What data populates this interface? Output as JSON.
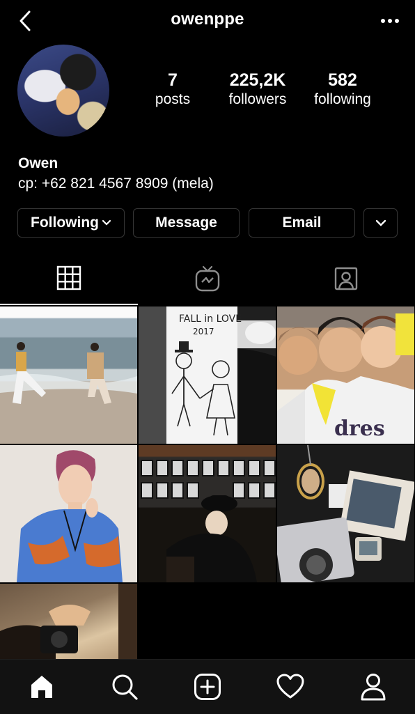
{
  "header": {
    "username": "owenppe",
    "back_icon": "chevron-left-icon",
    "more_icon": "ellipsis-icon"
  },
  "profile": {
    "stats": [
      {
        "count": "7",
        "label": "posts"
      },
      {
        "count": "225,2K",
        "label": "followers"
      },
      {
        "count": "582",
        "label": "following"
      }
    ],
    "name": "Owen",
    "bio": "cp: +62 821 4567 8909 (mela)"
  },
  "actions": {
    "following": "Following",
    "message": "Message",
    "email": "Email"
  },
  "tabs": [
    {
      "icon": "grid-icon",
      "active": true
    },
    {
      "icon": "igtv-icon",
      "active": false
    },
    {
      "icon": "tagged-icon",
      "active": false
    }
  ],
  "post2_text": {
    "line1": "FALL in LOVE",
    "line2": "2017"
  },
  "post3_text": "dres",
  "bottom_nav": [
    "home-icon",
    "search-icon",
    "create-icon",
    "heart-icon",
    "profile-icon"
  ],
  "colors": {
    "background": "#000000",
    "button_border": "#363636",
    "nav_background": "#121212"
  }
}
